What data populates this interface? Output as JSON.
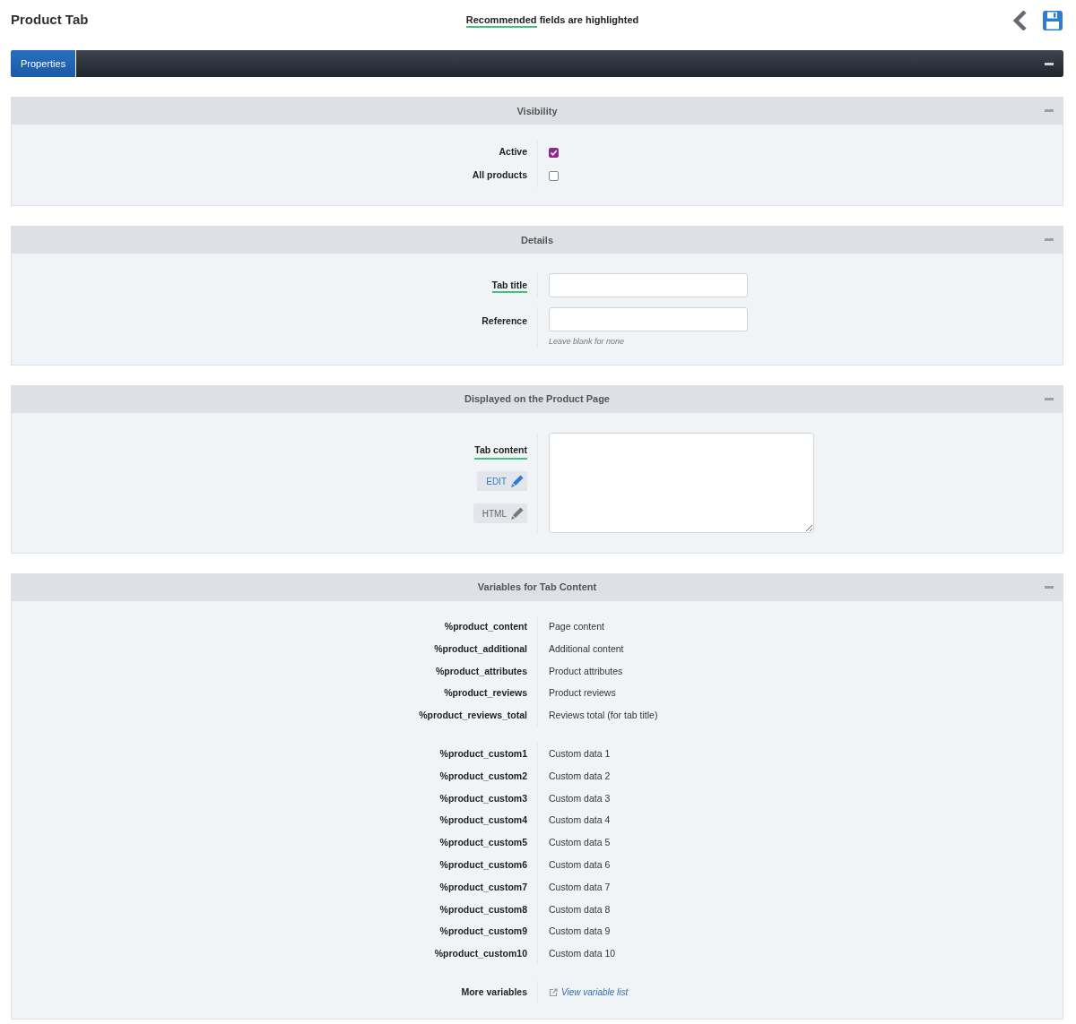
{
  "page": {
    "title": "Product Tab",
    "hint_mark": "Recommended",
    "hint_rest": "fields are highlighted"
  },
  "tabs": [
    {
      "label": "Properties",
      "selected": true
    }
  ],
  "sections": [
    {
      "kind": "checkboxes",
      "title": "Visibility",
      "rows": [
        {
          "label": "Active",
          "checked": true
        },
        {
          "label": "All products",
          "checked": false
        }
      ]
    },
    {
      "kind": "fields",
      "title": "Details",
      "rows": [
        {
          "label": "Tab title",
          "recommended": true
        },
        {
          "label": "Reference",
          "recommended": false,
          "help": "Leave blank for none"
        }
      ]
    },
    {
      "kind": "editor",
      "title": "Displayed on the Product Page",
      "label": "Tab content",
      "recommended": true,
      "buttons": [
        {
          "label": "EDIT",
          "selected": true
        },
        {
          "label": "HTML",
          "selected": false
        }
      ]
    },
    {
      "kind": "variables",
      "title": "Variables for Tab Content",
      "groups": [
        [
          {
            "name": "%product_content",
            "desc": "Page content"
          },
          {
            "name": "%product_additional",
            "desc": "Additional content"
          },
          {
            "name": "%product_attributes",
            "desc": "Product attributes"
          },
          {
            "name": "%product_reviews",
            "desc": "Product reviews"
          },
          {
            "name": "%product_reviews_total",
            "desc": "Reviews total (for tab title)"
          }
        ],
        [
          {
            "name": "%product_custom1",
            "desc": "Custom data 1"
          },
          {
            "name": "%product_custom2",
            "desc": "Custom data 2"
          },
          {
            "name": "%product_custom3",
            "desc": "Custom data 3"
          },
          {
            "name": "%product_custom4",
            "desc": "Custom data 4"
          },
          {
            "name": "%product_custom5",
            "desc": "Custom data 5"
          },
          {
            "name": "%product_custom6",
            "desc": "Custom data 6"
          },
          {
            "name": "%product_custom7",
            "desc": "Custom data 7"
          },
          {
            "name": "%product_custom8",
            "desc": "Custom data 8"
          },
          {
            "name": "%product_custom9",
            "desc": "Custom data 9"
          },
          {
            "name": "%product_custom10",
            "desc": "Custom data 10"
          }
        ]
      ],
      "more": {
        "label": "More variables",
        "link": "View variable list"
      }
    }
  ]
}
